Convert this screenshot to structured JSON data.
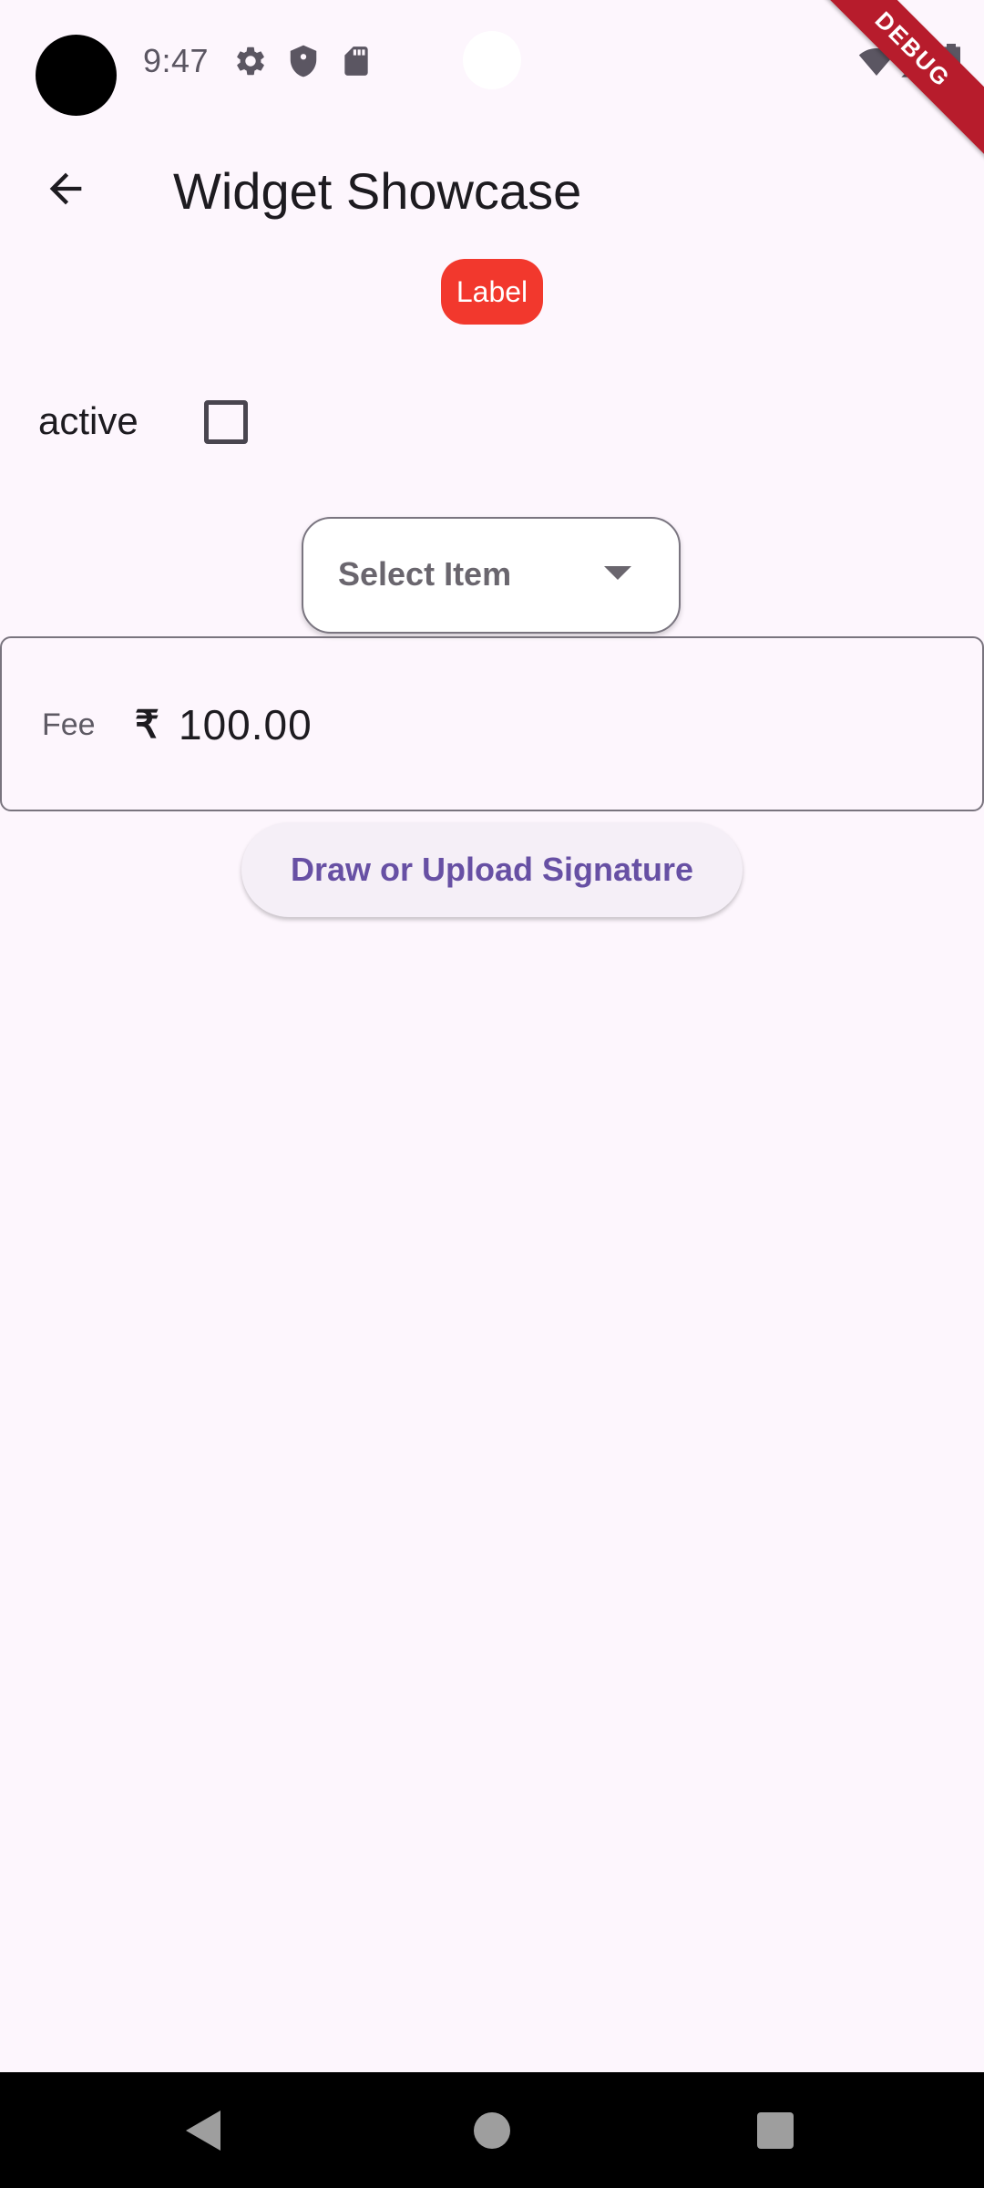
{
  "status_bar": {
    "time": "9:47",
    "icons": [
      "settings-icon",
      "shield-icon",
      "sd-card-icon",
      "wifi-icon",
      "signal-icon",
      "battery-icon"
    ],
    "debug_banner": "DEBUG"
  },
  "app_bar": {
    "title": "Widget Showcase",
    "back_icon": "arrow-back-icon"
  },
  "badge": {
    "label": "Label",
    "color": "#f2382d"
  },
  "checkbox": {
    "label": "active",
    "checked": false
  },
  "dropdown": {
    "placeholder": "Select Item",
    "icon": "arrow-drop-down-icon"
  },
  "fee_field": {
    "label": "Fee",
    "prefix": "₹",
    "value": "100.00"
  },
  "signature_button": {
    "label": "Draw or Upload Signature",
    "color": "#6750a4"
  },
  "nav_bar": {
    "icons": [
      "nav-back-icon",
      "nav-home-icon",
      "nav-recents-icon"
    ]
  },
  "colors": {
    "background": "#fdf6fd",
    "primary": "#6750a4",
    "badge": "#f2382d"
  }
}
